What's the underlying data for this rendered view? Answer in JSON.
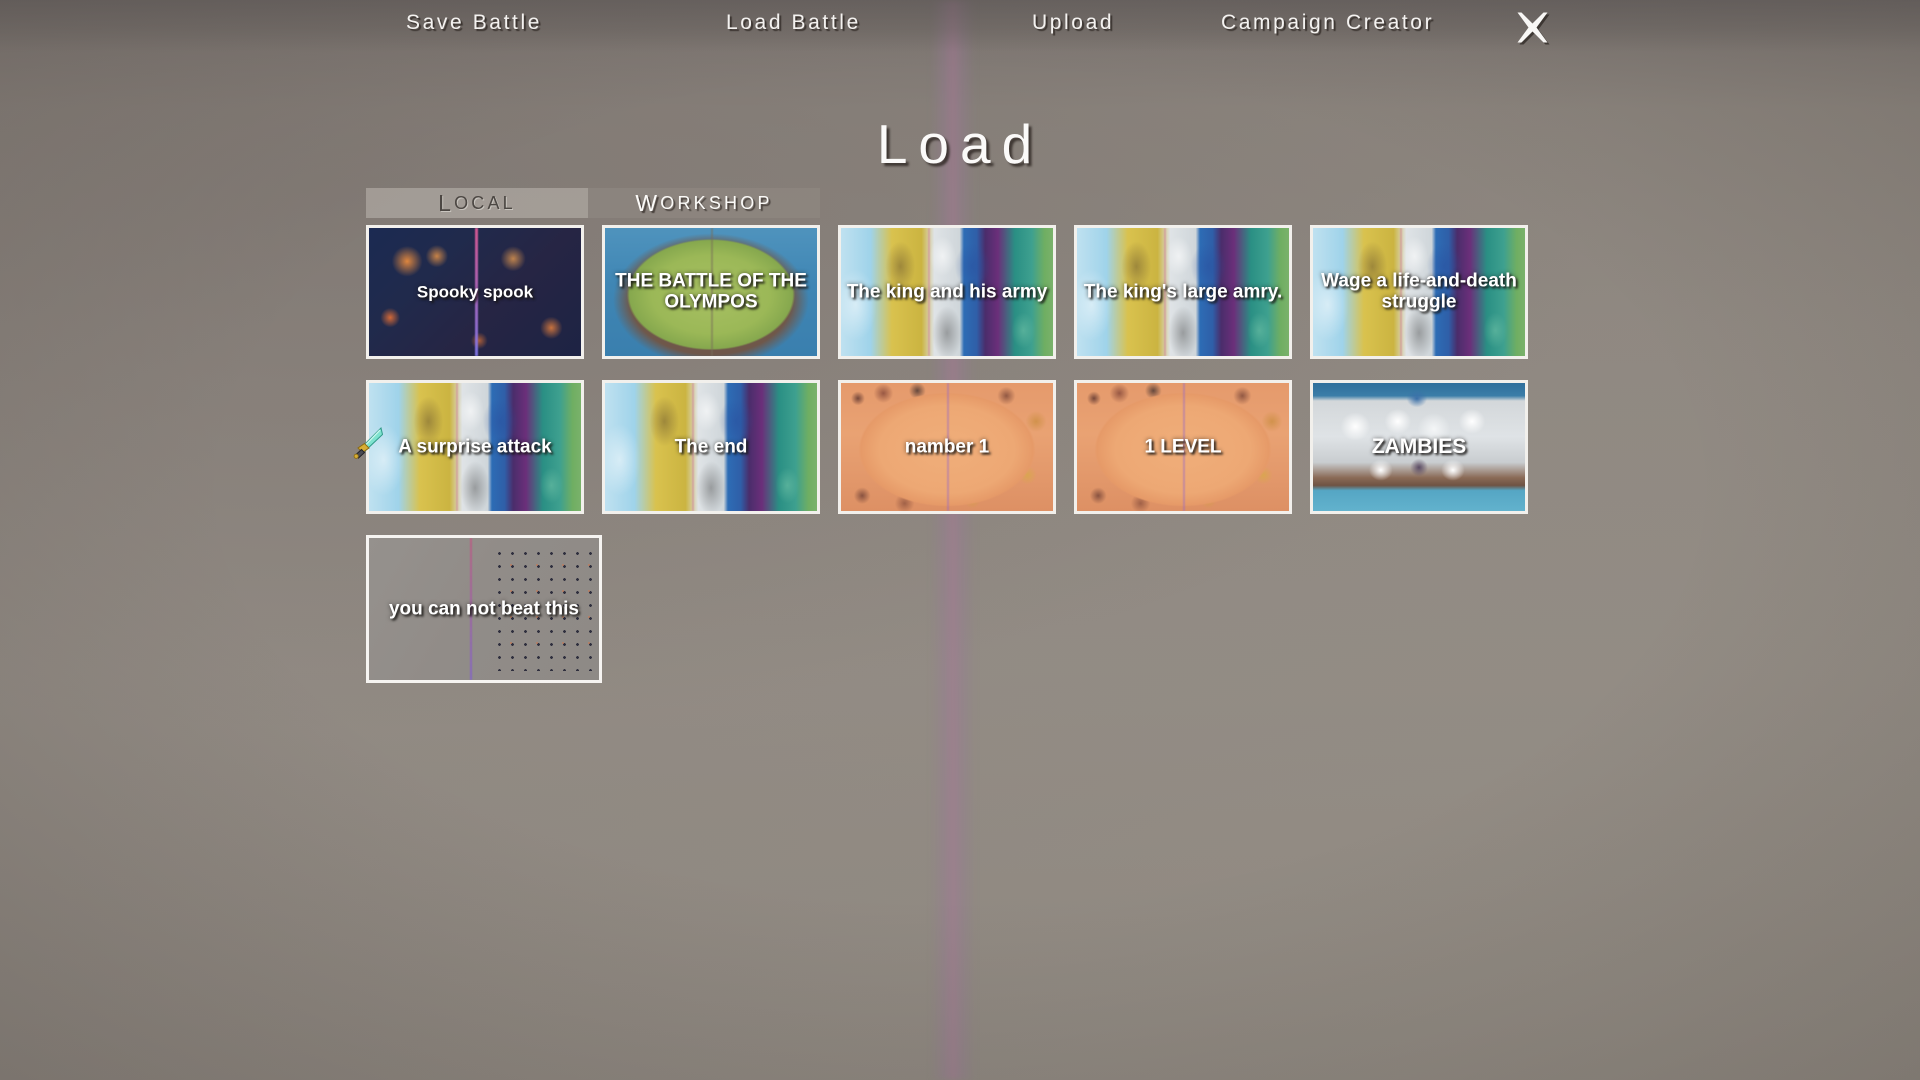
{
  "topnav": {
    "items": [
      {
        "id": "save-battle",
        "label": "Save Battle"
      },
      {
        "id": "load-battle",
        "label": "Load Battle"
      },
      {
        "id": "upload",
        "label": "Upload"
      },
      {
        "id": "campaign-creator",
        "label": "Campaign Creator"
      }
    ],
    "close_icon": "close-icon"
  },
  "page": {
    "title": "Load",
    "background_color": "#8e8780",
    "accent_stripe_color": "#a578a0",
    "title_color": "#fbfaf9"
  },
  "tabs": [
    {
      "id": "local",
      "label": "Local",
      "cap": "L",
      "rest": "OCAL",
      "selected": true
    },
    {
      "id": "workshop",
      "label": "Workshop",
      "cap": "W",
      "rest": "ORKSHOP",
      "selected": false
    }
  ],
  "grid": {
    "rows": [
      [
        {
          "id": "spooky-spook",
          "label": "Spooky spook",
          "thumb": "night-battlefield"
        },
        {
          "id": "battle-of-olympos",
          "label": "THE BATTLE OF THE OLYMPOS",
          "thumb": "green-island"
        },
        {
          "id": "king-and-his-army",
          "label": "The king and his army",
          "thumb": "composite-maps"
        },
        {
          "id": "kings-large-amry",
          "label": "The king's large amry.",
          "thumb": "composite-maps"
        },
        {
          "id": "wage-life-and-death-struggle",
          "label": "Wage a life-and-death struggle",
          "thumb": "composite-maps"
        }
      ],
      [
        {
          "id": "a-surprise-attack",
          "label": "A surprise attack",
          "thumb": "composite-maps"
        },
        {
          "id": "the-end",
          "label": "The end",
          "thumb": "composite-maps"
        },
        {
          "id": "namber-1",
          "label": "namber 1",
          "thumb": "desert-arena"
        },
        {
          "id": "1-level",
          "label": "1 LEVEL",
          "thumb": "desert-arena"
        },
        {
          "id": "zambies",
          "label": "ZAMBIES",
          "thumb": "white-city"
        }
      ],
      [
        {
          "id": "you-can-not-beat-this",
          "label": "you can not beat this",
          "thumb": "grey-plain-troops"
        }
      ]
    ]
  },
  "cursor": {
    "icon": "sword-cursor",
    "blade_color": "#5fd6c0",
    "hilt_color": "#c9a227"
  }
}
